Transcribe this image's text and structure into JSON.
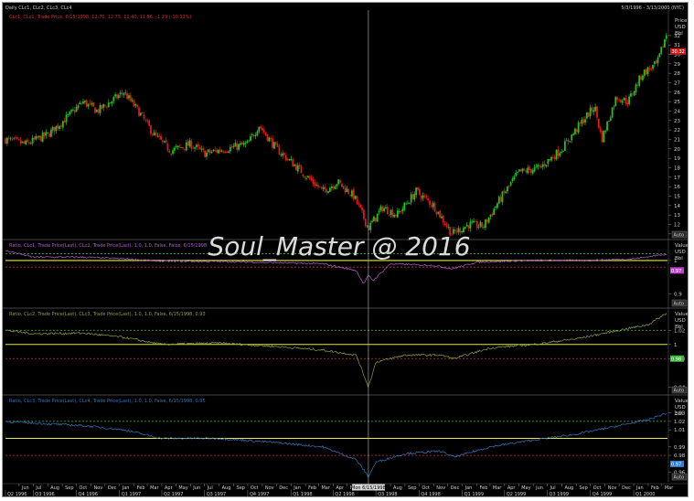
{
  "header": {
    "title": "Daily CLc1, CLc2, CLc3, CLc4",
    "date_range": "5/3/1996 - 3/13/2000 (NYC)"
  },
  "watermark": "Soul_Master @ 2016",
  "crosshair_label": "Mon 6/15/1998",
  "colors": {
    "background": "#000000",
    "candle_up": "#22c01e",
    "candle_down": "#e01818",
    "ratio1": "#b45cd0",
    "ratio2": "#8aa23c",
    "ratio3": "#2f78c0",
    "yellow_line": "#e6e64a",
    "green_dash": "#33c433",
    "red_dash": "#d23030"
  },
  "chart_data": [
    {
      "type": "candlestick",
      "legend": "CLc1, CLc1, Trade Price, 6/15/1998, 12.70, 12.75, 11.40, 11.56, -1.29 (-10.12%)",
      "axis_header": [
        "Price",
        "USD",
        "Bbl"
      ],
      "y_ticks": [
        11,
        12,
        13,
        14,
        15,
        16,
        17,
        18,
        19,
        20,
        21,
        22,
        23,
        24,
        25,
        26,
        27,
        28,
        29,
        30,
        31,
        32
      ],
      "last_value_label": "30.32",
      "ylim": [
        10.5,
        34.5
      ],
      "x_range": [
        "1996-05-03",
        "2000-03-13"
      ],
      "series_points": [
        [
          "1996-05-03",
          21.0
        ],
        [
          "1996-06-15",
          20.5
        ],
        [
          "1996-08-01",
          21.5
        ],
        [
          "1996-09-15",
          23.5
        ],
        [
          "1996-10-15",
          25.0
        ],
        [
          "1996-11-15",
          24.0
        ],
        [
          "1997-01-10",
          26.0
        ],
        [
          "1997-02-10",
          24.0
        ],
        [
          "1997-03-15",
          21.5
        ],
        [
          "1997-04-20",
          19.8
        ],
        [
          "1997-06-01",
          20.5
        ],
        [
          "1997-07-01",
          19.5
        ],
        [
          "1997-08-15",
          20.0
        ],
        [
          "1997-10-01",
          20.5
        ],
        [
          "1997-10-25",
          22.5
        ],
        [
          "1997-12-01",
          20.0
        ],
        [
          "1998-01-15",
          18.0
        ],
        [
          "1998-03-10",
          15.5
        ],
        [
          "1998-04-10",
          16.5
        ],
        [
          "1998-05-15",
          15.0
        ],
        [
          "1998-06-15",
          11.6
        ],
        [
          "1998-07-15",
          13.8
        ],
        [
          "1998-08-15",
          13.0
        ],
        [
          "1998-09-25",
          15.5
        ],
        [
          "1998-11-01",
          14.0
        ],
        [
          "1998-12-10",
          11.0
        ],
        [
          "1999-01-15",
          12.0
        ],
        [
          "1999-02-15",
          11.8
        ],
        [
          "1999-03-20",
          14.5
        ],
        [
          "1999-05-01",
          17.5
        ],
        [
          "1999-06-15",
          18.0
        ],
        [
          "1999-08-01",
          20.0
        ],
        [
          "1999-09-15",
          23.0
        ],
        [
          "1999-10-10",
          24.5
        ],
        [
          "1999-10-25",
          21.0
        ],
        [
          "1999-11-25",
          25.5
        ],
        [
          "1999-12-20",
          25.0
        ],
        [
          "2000-01-20",
          28.0
        ],
        [
          "2000-02-20",
          29.0
        ],
        [
          "2000-03-13",
          32.5
        ]
      ]
    },
    {
      "type": "line",
      "legend": "Ratio, CLc1, Trade Price(Last), CLc2, Trade Price(Last), 1.0, 1.0, False, False, 6/15/1998",
      "axis_header": [
        "Value",
        "USD",
        "Bbl"
      ],
      "y_ticks": [
        1,
        0.9
      ],
      "last_value_label": "0.97",
      "ylim": [
        0.86,
        1.06
      ],
      "reference_lines": {
        "yellow": 1.0,
        "green_dash": 1.02,
        "red_dash": 0.98
      },
      "series_points": [
        [
          "1996-05-03",
          1.03
        ],
        [
          "1996-07-01",
          1.01
        ],
        [
          "1996-10-15",
          1.01
        ],
        [
          "1997-01-10",
          1.005
        ],
        [
          "1997-04-01",
          0.998
        ],
        [
          "1997-08-01",
          0.997
        ],
        [
          "1997-12-01",
          0.993
        ],
        [
          "1998-03-10",
          0.99
        ],
        [
          "1998-05-20",
          0.97
        ],
        [
          "1998-06-05",
          0.93
        ],
        [
          "1998-06-15",
          0.955
        ],
        [
          "1998-06-25",
          0.94
        ],
        [
          "1998-08-01",
          0.99
        ],
        [
          "1998-11-01",
          0.985
        ],
        [
          "1998-12-10",
          0.975
        ],
        [
          "1999-02-01",
          0.995
        ],
        [
          "1999-06-01",
          1.0
        ],
        [
          "1999-10-01",
          1.0
        ],
        [
          "2000-01-01",
          1.005
        ],
        [
          "2000-03-13",
          1.02
        ]
      ]
    },
    {
      "type": "line",
      "legend": "Ratio, CLc2, Trade Price(Last), CLc3, Trade Price(Last), 1.0, 1.0, False, 6/15/1998, 0.93",
      "axis_header": [
        "Value",
        "USD",
        "Bbl"
      ],
      "y_ticks": [
        1.02,
        1,
        0.98,
        0.94
      ],
      "last_value_label": "0.98",
      "ylim": [
        0.93,
        1.05
      ],
      "reference_lines": {
        "yellow": 1.0,
        "green_dash": 1.02,
        "red_dash": 0.98
      },
      "series_points": [
        [
          "1996-05-03",
          1.02
        ],
        [
          "1996-07-01",
          1.015
        ],
        [
          "1996-10-15",
          1.016
        ],
        [
          "1997-01-10",
          1.01
        ],
        [
          "1997-04-01",
          1.0
        ],
        [
          "1997-08-01",
          1.002
        ],
        [
          "1997-12-01",
          0.997
        ],
        [
          "1998-03-10",
          0.992
        ],
        [
          "1998-05-20",
          0.985
        ],
        [
          "1998-06-15",
          0.94
        ],
        [
          "1998-07-01",
          0.975
        ],
        [
          "1998-09-01",
          0.985
        ],
        [
          "1998-11-15",
          0.985
        ],
        [
          "1998-12-15",
          0.98
        ],
        [
          "1999-03-01",
          0.995
        ],
        [
          "1999-06-01",
          1.0
        ],
        [
          "1999-09-01",
          1.008
        ],
        [
          "1999-12-01",
          1.02
        ],
        [
          "2000-02-01",
          1.028
        ],
        [
          "2000-03-13",
          1.045
        ]
      ]
    },
    {
      "type": "line",
      "legend": "Ratio, CLc3, Trade Price(Last), CLc4, Trade Price(Last), 1.0, 1.0, False, 6/15/1998, 0.95",
      "axis_header": [
        "Value",
        "USD",
        "Bbl"
      ],
      "y_ticks": [
        1.03,
        1.02,
        1.01,
        0.99,
        0.98,
        0.96
      ],
      "last_value_label": "0.97",
      "ylim": [
        0.95,
        1.05
      ],
      "reference_lines": {
        "yellow": 1.0,
        "green_dash": 1.02,
        "red_dash": 0.98
      },
      "series_points": [
        [
          "1996-05-03",
          1.02
        ],
        [
          "1996-07-01",
          1.018
        ],
        [
          "1996-10-15",
          1.015
        ],
        [
          "1997-01-10",
          1.01
        ],
        [
          "1997-04-01",
          1.0
        ],
        [
          "1997-08-01",
          1.0
        ],
        [
          "1997-12-01",
          0.995
        ],
        [
          "1998-03-10",
          0.99
        ],
        [
          "1998-05-20",
          0.975
        ],
        [
          "1998-06-15",
          0.955
        ],
        [
          "1998-07-01",
          0.972
        ],
        [
          "1998-09-01",
          0.982
        ],
        [
          "1998-11-15",
          0.985
        ],
        [
          "1998-12-15",
          0.978
        ],
        [
          "1999-03-01",
          0.99
        ],
        [
          "1999-06-01",
          0.998
        ],
        [
          "1999-09-01",
          1.005
        ],
        [
          "1999-12-01",
          1.015
        ],
        [
          "2000-02-01",
          1.022
        ],
        [
          "2000-03-13",
          1.03
        ]
      ]
    }
  ],
  "x_axis": {
    "months": [
      [
        "1996-06-01",
        "Jun"
      ],
      [
        "1996-07-01",
        "Jul"
      ],
      [
        "1996-08-01",
        "Aug"
      ],
      [
        "1996-09-01",
        "Sep"
      ],
      [
        "1996-10-01",
        "Oct"
      ],
      [
        "1996-11-01",
        "Nov"
      ],
      [
        "1996-12-01",
        "Dec"
      ],
      [
        "1997-01-01",
        "Jan"
      ],
      [
        "1997-02-01",
        "Feb"
      ],
      [
        "1997-03-01",
        "Mar"
      ],
      [
        "1997-04-01",
        "Apr"
      ],
      [
        "1997-05-01",
        "May"
      ],
      [
        "1997-06-01",
        "Jun"
      ],
      [
        "1997-07-01",
        "Jul"
      ],
      [
        "1997-08-01",
        "Aug"
      ],
      [
        "1997-09-01",
        "Sep"
      ],
      [
        "1997-10-01",
        "Oct"
      ],
      [
        "1997-11-01",
        "Nov"
      ],
      [
        "1997-12-01",
        "Dec"
      ],
      [
        "1998-01-01",
        "Jan"
      ],
      [
        "1998-02-01",
        "Feb"
      ],
      [
        "1998-03-01",
        "Mar"
      ],
      [
        "1998-04-01",
        "Apr"
      ],
      [
        "1998-05-01",
        "May"
      ],
      [
        "1998-06-01",
        "Jun"
      ],
      [
        "1998-07-01",
        "Jul"
      ],
      [
        "1998-08-01",
        "Aug"
      ],
      [
        "1998-09-01",
        "Sep"
      ],
      [
        "1998-10-01",
        "Oct"
      ],
      [
        "1998-11-01",
        "Nov"
      ],
      [
        "1998-12-01",
        "Dec"
      ],
      [
        "1999-01-01",
        "Jan"
      ],
      [
        "1999-02-01",
        "Feb"
      ],
      [
        "1999-03-01",
        "Mar"
      ],
      [
        "1999-04-01",
        "Apr"
      ],
      [
        "1999-05-01",
        "May"
      ],
      [
        "1999-06-01",
        "Jun"
      ],
      [
        "1999-07-01",
        "Jul"
      ],
      [
        "1999-08-01",
        "Aug"
      ],
      [
        "1999-09-01",
        "Sep"
      ],
      [
        "1999-10-01",
        "Oct"
      ],
      [
        "1999-11-01",
        "Nov"
      ],
      [
        "1999-12-01",
        "Dec"
      ],
      [
        "2000-01-01",
        "Jan"
      ],
      [
        "2000-02-01",
        "Feb"
      ],
      [
        "2000-03-01",
        "Mar"
      ]
    ],
    "quarters": [
      [
        "1996-05-03",
        "Q2 1996"
      ],
      [
        "1996-07-01",
        "Q3 1996"
      ],
      [
        "1996-10-01",
        "Q4 1996"
      ],
      [
        "1997-01-01",
        "Q1 1997"
      ],
      [
        "1997-04-01",
        "Q2 1997"
      ],
      [
        "1997-07-01",
        "Q3 1997"
      ],
      [
        "1997-10-01",
        "Q4 1997"
      ],
      [
        "1998-01-01",
        "Q1 1998"
      ],
      [
        "1998-04-01",
        "Q2 1998"
      ],
      [
        "1998-07-01",
        "Q3 1998"
      ],
      [
        "1998-10-01",
        "Q4 1998"
      ],
      [
        "1999-01-01",
        "Q1 1999"
      ],
      [
        "1999-04-01",
        "Q2 1999"
      ],
      [
        "1999-07-01",
        "Q3 1999"
      ],
      [
        "1999-10-01",
        "Q4 1999"
      ],
      [
        "2000-01-01",
        "Q1 2000"
      ]
    ]
  },
  "auto_label": "Auto"
}
